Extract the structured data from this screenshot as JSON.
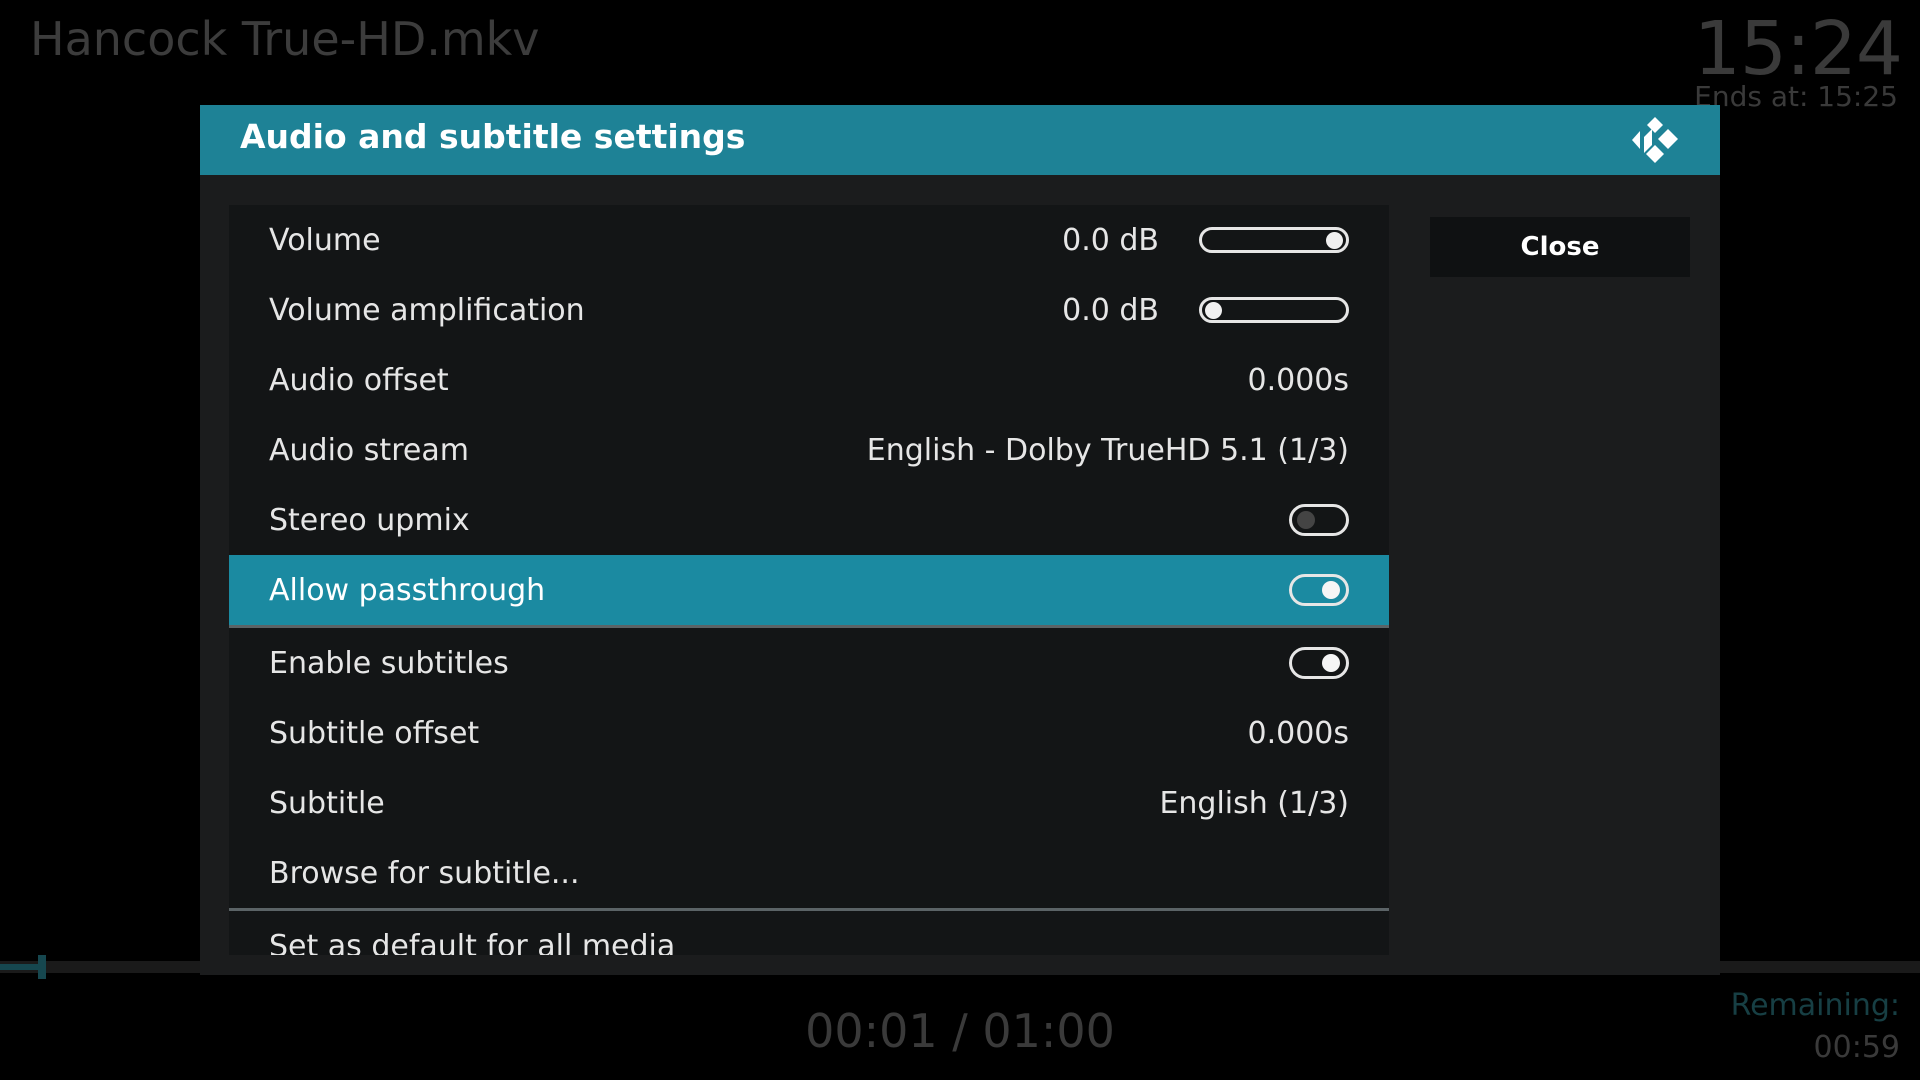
{
  "osd": {
    "media_title": "Hancock True-HD.mkv",
    "clock": "15:24",
    "ends_at": "Ends at: 15:25",
    "time_readout": "00:01 / 01:00",
    "remaining_label": "Remaining:",
    "remaining_value": "00:59",
    "progress_fraction": 0.017
  },
  "dialog": {
    "title": "Audio and subtitle settings",
    "close_label": "Close",
    "logo": "kodi-logo-icon",
    "accent_color": "#1e8296"
  },
  "settings": {
    "volume": {
      "label": "Volume",
      "value": "0.0 dB",
      "slider_level": 1.0
    },
    "volume_amp": {
      "label": "Volume amplification",
      "value": "0.0 dB",
      "slider_level": 0.0
    },
    "audio_offset": {
      "label": "Audio offset",
      "value": "0.000s"
    },
    "audio_stream": {
      "label": "Audio stream",
      "value": "English - Dolby TrueHD 5.1 (1/3)"
    },
    "stereo_upmix": {
      "label": "Stereo upmix",
      "enabled": false
    },
    "allow_passthrough": {
      "label": "Allow passthrough",
      "enabled": true
    },
    "enable_subtitles": {
      "label": "Enable subtitles",
      "enabled": true
    },
    "subtitle_offset": {
      "label": "Subtitle offset",
      "value": "0.000s"
    },
    "subtitle": {
      "label": "Subtitle",
      "value": "English (1/3)"
    },
    "browse_subtitle": {
      "label": "Browse for subtitle..."
    },
    "set_default": {
      "label": "Set as default for all media"
    }
  }
}
